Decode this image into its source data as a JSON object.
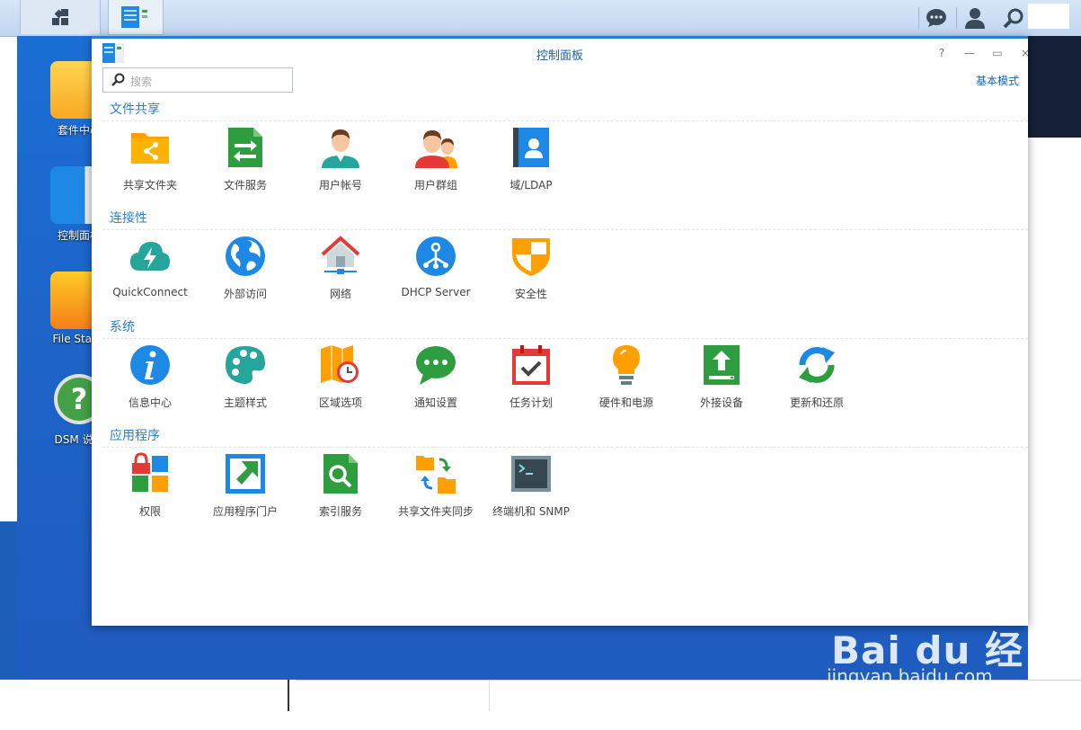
{
  "taskbar": {
    "grid_icon": "grid-icon",
    "app_icon": "control-panel-icon",
    "right_icons": [
      "chat-icon",
      "user-icon",
      "search-icon"
    ]
  },
  "desktop": {
    "icons": [
      {
        "label": "套件中心"
      },
      {
        "label": "控制面板"
      },
      {
        "label": "File Statio"
      },
      {
        "label": "DSM 说明"
      }
    ]
  },
  "window": {
    "title": "控制面板",
    "controls": [
      "?",
      "—",
      "▭",
      "×"
    ],
    "search_placeholder": "搜索",
    "basic_mode": "基本模式"
  },
  "sections": [
    {
      "title": "文件共享",
      "items": [
        {
          "label": "共享文件夹",
          "icon": "shared-folder-icon"
        },
        {
          "label": "文件服务",
          "icon": "file-services-icon"
        },
        {
          "label": "用户帐号",
          "icon": "user-account-icon"
        },
        {
          "label": "用户群组",
          "icon": "user-group-icon"
        },
        {
          "label": "域/LDAP",
          "icon": "domain-ldap-icon"
        }
      ]
    },
    {
      "title": "连接性",
      "items": [
        {
          "label": "QuickConnect",
          "icon": "quickconnect-icon"
        },
        {
          "label": "外部访问",
          "icon": "external-access-icon"
        },
        {
          "label": "网络",
          "icon": "network-icon"
        },
        {
          "label": "DHCP Server",
          "icon": "dhcp-server-icon"
        },
        {
          "label": "安全性",
          "icon": "security-shield-icon"
        }
      ]
    },
    {
      "title": "系统",
      "items": [
        {
          "label": "信息中心",
          "icon": "info-center-icon"
        },
        {
          "label": "主题样式",
          "icon": "theme-palette-icon"
        },
        {
          "label": "区域选项",
          "icon": "regional-options-icon"
        },
        {
          "label": "通知设置",
          "icon": "notification-icon"
        },
        {
          "label": "任务计划",
          "icon": "task-scheduler-icon"
        },
        {
          "label": "硬件和电源",
          "icon": "hardware-power-icon"
        },
        {
          "label": "外接设备",
          "icon": "external-devices-icon"
        },
        {
          "label": "更新和还原",
          "icon": "update-restore-icon"
        }
      ]
    },
    {
      "title": "应用程序",
      "items": [
        {
          "label": "权限",
          "icon": "privileges-icon"
        },
        {
          "label": "应用程序门户",
          "icon": "application-portal-icon"
        },
        {
          "label": "索引服务",
          "icon": "indexing-service-icon"
        },
        {
          "label": "共享文件夹同步",
          "icon": "shared-folder-sync-icon"
        },
        {
          "label": "终端机和 SNMP",
          "icon": "terminal-snmp-icon"
        }
      ]
    }
  ],
  "watermark": {
    "main": "Bai du 经验",
    "sub": "jingyan.baidu.com"
  }
}
